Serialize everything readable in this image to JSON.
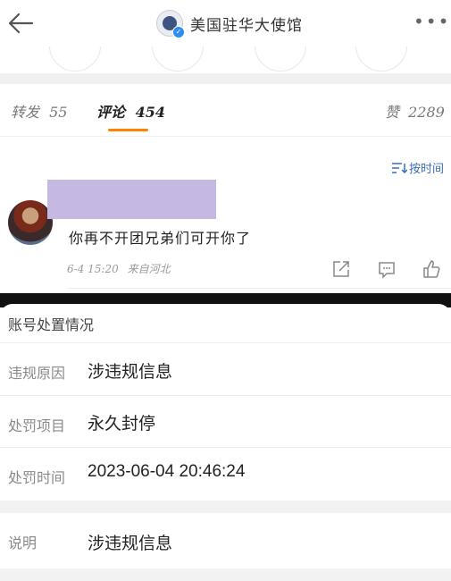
{
  "header": {
    "title": "美国驻华大使馆",
    "back_icon": "back-arrow-icon",
    "more_icon": "more-icon",
    "more_label": "•••"
  },
  "tabs": {
    "reposts_label": "转发",
    "reposts_count": "55",
    "comments_label": "评论",
    "comments_count": "454",
    "likes_label": "赞",
    "likes_count": "2289",
    "accent": "#ff8200"
  },
  "sort": {
    "label": "按时间",
    "color": "#3a6fb5"
  },
  "comment": {
    "text": "你再不开团兄弟们可开你了",
    "date": "6-4 15:20",
    "location": "来自河北",
    "redaction_color": "#c5b9e3"
  },
  "moderation": {
    "header": "账号处置情况",
    "rows": [
      {
        "label": "违规原因",
        "value": "涉违规信息"
      },
      {
        "label": "处罚项目",
        "value": "永久封停"
      },
      {
        "label": "处罚时间",
        "value": "2023-06-04 20:46:24"
      }
    ],
    "note": {
      "label": "说明",
      "value": "涉违规信息"
    }
  }
}
